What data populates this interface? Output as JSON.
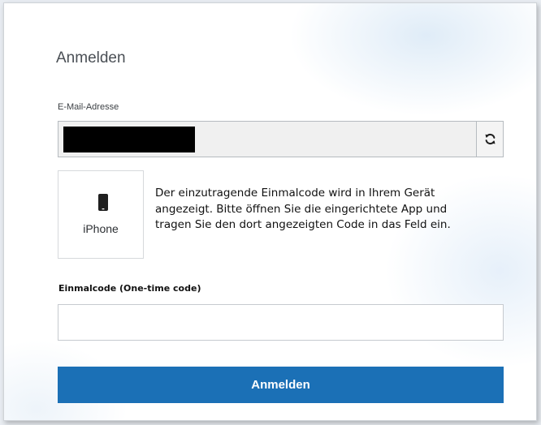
{
  "login": {
    "title": "Anmelden",
    "email_label": "E-Mail-Adresse",
    "email_value": "",
    "refresh_icon": "refresh-icon",
    "device": {
      "icon": "smartphone-icon",
      "name": "iPhone"
    },
    "instruction": "Der einzutragende Einmalcode wird in Ihrem Gerät angezeigt. Bitte öffnen Sie die eingerichtete App und tragen Sie den dort angezeigten Code in das Feld ein.",
    "code_label": "Einmalcode (One-time code)",
    "code_value": "",
    "code_placeholder": "",
    "submit_label": "Anmelden"
  },
  "colors": {
    "primary_button": "#1b70b6",
    "email_field_background": "#f0f0f0",
    "redaction": "#000000"
  }
}
